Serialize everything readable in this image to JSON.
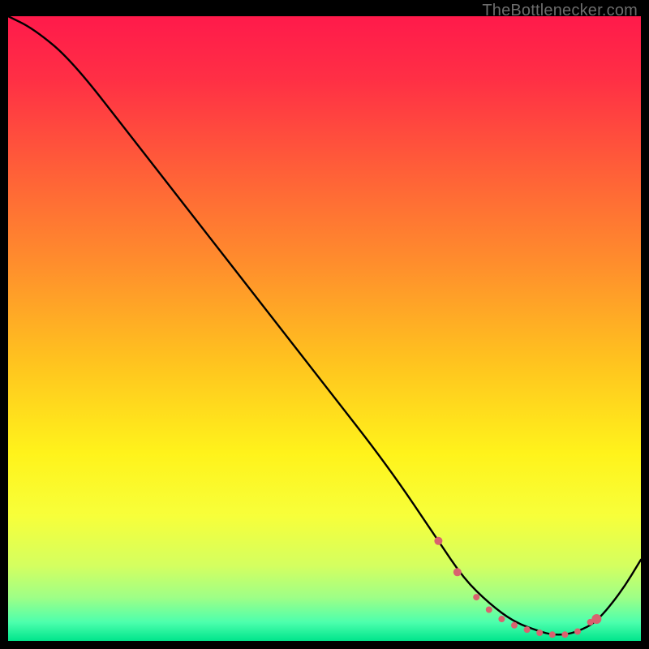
{
  "attribution": "TheBottlenecker.com",
  "chart_data": {
    "type": "line",
    "title": "",
    "xlabel": "",
    "ylabel": "",
    "xlim": [
      0,
      100
    ],
    "ylim": [
      0,
      100
    ],
    "series": [
      {
        "name": "curve",
        "x": [
          0,
          4,
          10,
          20,
          30,
          40,
          50,
          60,
          68,
          72,
          76,
          80,
          84,
          86,
          88,
          90,
          93,
          97,
          100
        ],
        "y": [
          100,
          98,
          93,
          80,
          67,
          54,
          41,
          28,
          16,
          10,
          6,
          3,
          1.5,
          1,
          1,
          1.5,
          3,
          8,
          13
        ]
      }
    ],
    "markers": {
      "name": "highlight-dots",
      "color": "#d9626f",
      "x": [
        68,
        71,
        74,
        76,
        78,
        80,
        82,
        84,
        86,
        88,
        90,
        92,
        93
      ],
      "y": [
        16,
        11,
        7,
        5,
        3.5,
        2.5,
        1.8,
        1.3,
        1,
        1,
        1.5,
        3,
        3.5
      ],
      "r": [
        5,
        5,
        4,
        4,
        4,
        4,
        4,
        4,
        4,
        4,
        4,
        4,
        6
      ]
    },
    "gradient_stops": [
      {
        "offset": 0.0,
        "color": "#ff1a4b"
      },
      {
        "offset": 0.1,
        "color": "#ff2f45"
      },
      {
        "offset": 0.25,
        "color": "#ff6038"
      },
      {
        "offset": 0.4,
        "color": "#ff8f2c"
      },
      {
        "offset": 0.55,
        "color": "#ffc21f"
      },
      {
        "offset": 0.7,
        "color": "#fff31b"
      },
      {
        "offset": 0.8,
        "color": "#f7ff3a"
      },
      {
        "offset": 0.88,
        "color": "#d4ff60"
      },
      {
        "offset": 0.93,
        "color": "#9fff86"
      },
      {
        "offset": 0.97,
        "color": "#4dffad"
      },
      {
        "offset": 1.0,
        "color": "#00e58c"
      }
    ]
  }
}
